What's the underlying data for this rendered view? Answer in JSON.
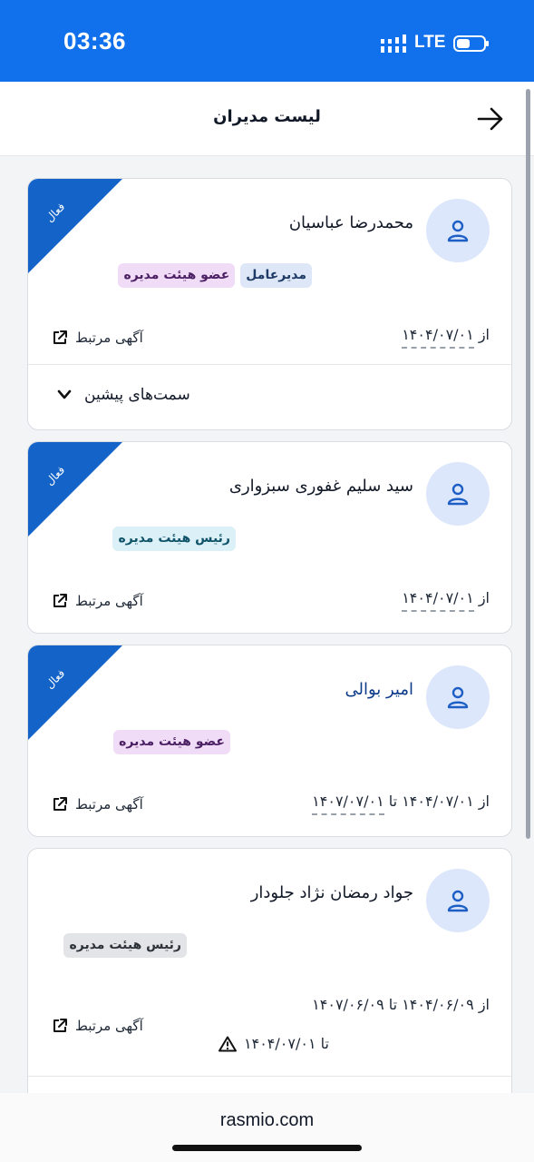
{
  "status_bar": {
    "time": "03:36",
    "network": "LTE",
    "icons": [
      "signal-icon",
      "battery-icon"
    ]
  },
  "header": {
    "title": "لیست مدیران",
    "back_icon": "arrow-right-icon"
  },
  "colors": {
    "accent": "#1170ec",
    "ribbon": "#1463c9",
    "avatar_bg": "#dde7fb"
  },
  "cards": [
    {
      "status": "فعال",
      "name": "محمدرضا عباسیان",
      "badges": [
        "عضو هیئت مدیره",
        "مدیرعامل"
      ],
      "date_prefix": "از",
      "date_value": "۱۴۰۴/۰۷/۰۱",
      "related_label": "آگهی مرتبط",
      "history_label": "سمت‌های پیشین"
    },
    {
      "status": "فعال",
      "name": "سید سلیم غفوری سبزواری",
      "badges": [
        "رئیس هیئت مدیره"
      ],
      "date_prefix": "از",
      "date_value": "۱۴۰۴/۰۷/۰۱",
      "related_label": "آگهی مرتبط"
    },
    {
      "status": "فعال",
      "name": "امیر بوالی",
      "badges": [
        "عضو هیئت مدیره"
      ],
      "date_prefix": "از ۱۴۰۴/۰۷/۰۱ تا",
      "date_value": "۱۴۰۷/۰۷/۰۱",
      "related_label": "آگهی مرتبط"
    },
    {
      "name": "جواد رمضان نژاد جلودار",
      "badges": [
        "رئیس هیئت مدیره"
      ],
      "date_text": "از ۱۴۰۴/۰۶/۰۹ تا ۱۴۰۷/۰۶/۰۹",
      "warning_text": "تا ۱۴۰۴/۰۷/۰۱",
      "related_label": "آگهی مرتبط"
    }
  ],
  "browser": {
    "url": "rasmio.com"
  }
}
